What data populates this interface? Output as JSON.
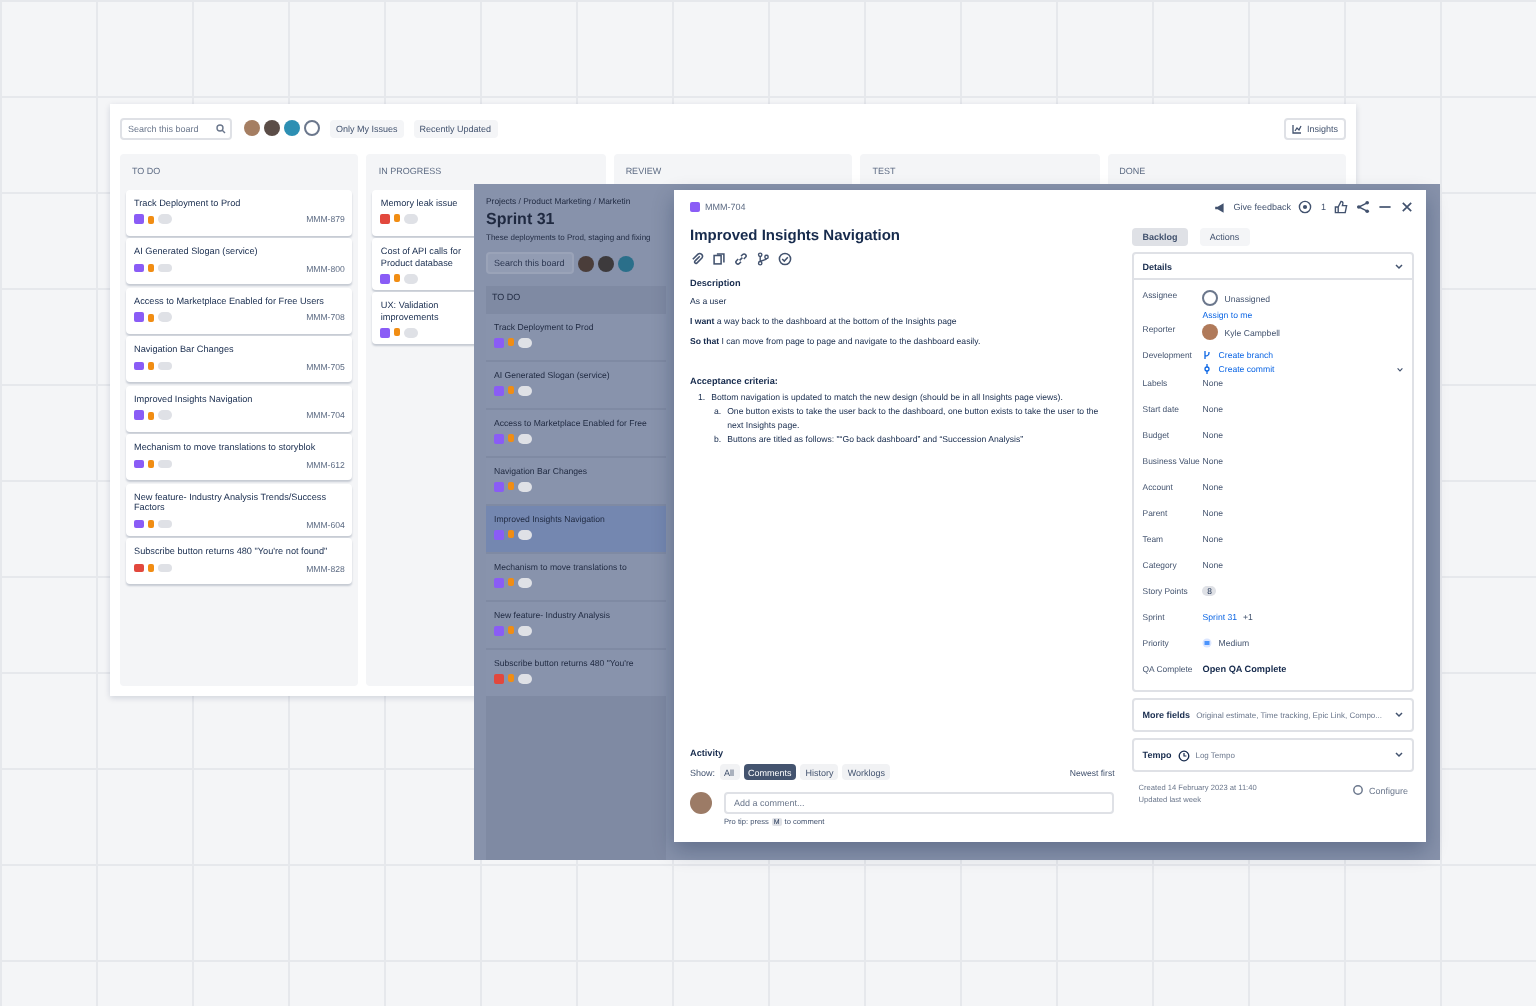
{
  "back_board": {
    "search": {
      "placeholder": "Search this board"
    },
    "filters": [
      "Only My Issues",
      "Recently Updated"
    ],
    "insights": "Insights",
    "columns": [
      {
        "title": "TO DO",
        "cards": [
          {
            "title": "Track Deployment to Prod",
            "key": "MMM-879",
            "kind": "story"
          },
          {
            "title": "AI Generated Slogan (service)",
            "key": "MMM-800",
            "kind": "story"
          },
          {
            "title": "Access to Marketplace Enabled for Free Users",
            "key": "MMM-708",
            "kind": "story"
          },
          {
            "title": "Navigation Bar Changes",
            "key": "MMM-705",
            "kind": "story"
          },
          {
            "title": "Improved Insights Navigation",
            "key": "MMM-704",
            "kind": "story"
          },
          {
            "title": "Mechanism to move translations to storyblok",
            "key": "MMM-612",
            "kind": "story"
          },
          {
            "title": "New feature- Industry Analysis Trends/Success Factors",
            "key": "MMM-604",
            "kind": "story"
          },
          {
            "title": "Subscribe button returns 480 \"You're not found\"",
            "key": "MMM-828",
            "kind": "bug"
          }
        ]
      },
      {
        "title": "IN PROGRESS",
        "cards": [
          {
            "title": "Memory leak issue",
            "kind": "bug"
          },
          {
            "title": "Cost of API calls for Product database",
            "kind": "story"
          },
          {
            "title": "UX: Validation improvements",
            "kind": "story"
          }
        ]
      },
      {
        "title": "REVIEW"
      },
      {
        "title": "TEST"
      },
      {
        "title": "DONE"
      }
    ]
  },
  "sprint_board": {
    "breadcrumb": "Projects / Product Marketing / Marketin",
    "title": "Sprint 31",
    "subtitle": "These deployments to Prod, staging and fixing",
    "search": {
      "placeholder": "Search this board"
    },
    "column": "TO DO",
    "cards": [
      {
        "title": "Track Deployment to Prod",
        "kind": "story",
        "selected": false
      },
      {
        "title": "AI Generated Slogan (service)",
        "kind": "story",
        "selected": false
      },
      {
        "title": "Access to Marketplace Enabled for Free",
        "kind": "story",
        "selected": false
      },
      {
        "title": "Navigation Bar Changes",
        "kind": "story",
        "selected": false
      },
      {
        "title": "Improved Insights Navigation",
        "kind": "story",
        "selected": true
      },
      {
        "title": "Mechanism to move translations to",
        "kind": "story",
        "selected": false
      },
      {
        "title": "New feature- Industry Analysis",
        "kind": "story",
        "selected": false
      },
      {
        "title": "Subscribe button returns 480 \"You're",
        "kind": "bug",
        "selected": false
      }
    ]
  },
  "issue": {
    "key": "MMM-704",
    "title": "Improved Insights Navigation",
    "description_label": "Description",
    "description": [
      "As a user",
      "**I want** a way back to the dashboard at the bottom of the Insights page",
      "**So that** I can move from page to page and navigate to the dashboard easily."
    ],
    "criteria_label": "Acceptance criteria:",
    "criteria": [
      {
        "marker": "1.",
        "text": "Bottom navigation is updated to match the new design (should be in all Insights page views).",
        "children": [
          {
            "marker": "a.",
            "text": "One button exists to take the user back to the dashboard, one button exists to take the user to the next Insights page."
          },
          {
            "marker": "b.",
            "text": "Buttons are titled as follows: \"“Go back dashboard” and “Succession Analysis”"
          }
        ]
      }
    ],
    "activity": {
      "label": "Activity",
      "show": "Show:",
      "tabs": [
        {
          "label": "All",
          "selected": false
        },
        {
          "label": "Comments",
          "selected": true
        },
        {
          "label": "History",
          "selected": false
        },
        {
          "label": "Worklogs",
          "selected": false
        }
      ],
      "sort": "Newest first",
      "comment": {
        "placeholder": "Add a comment..."
      },
      "tip_before": "Pro tip: press",
      "tip_key": "M",
      "tip_after": "to comment"
    },
    "feedback": "Give feedback",
    "watchers": "1",
    "status": "Backlog",
    "actions": "Actions",
    "details_label": "Details",
    "fields": [
      {
        "label": "Assignee",
        "value": "Unassigned",
        "kind": "person",
        "link": "Assign to me"
      },
      {
        "label": "Reporter",
        "value": "Kyle Campbell",
        "kind": "person"
      },
      {
        "label": "Development",
        "value": "Create branch",
        "kind": "dev",
        "second": "Create commit"
      },
      {
        "label": "Labels",
        "value": "None",
        "kind": "plain"
      },
      {
        "label": "Start date",
        "value": "None",
        "kind": "plain"
      },
      {
        "label": "Budget",
        "value": "None",
        "kind": "plain"
      },
      {
        "label": "Business Value",
        "value": "None",
        "kind": "plain"
      },
      {
        "label": "Account",
        "value": "None",
        "kind": "plain"
      },
      {
        "label": "Parent",
        "value": "None",
        "kind": "plain"
      },
      {
        "label": "Team",
        "value": "None",
        "kind": "plain"
      },
      {
        "label": "Category",
        "value": "None",
        "kind": "plain"
      },
      {
        "label": "Story Points",
        "value": "8",
        "kind": "points"
      },
      {
        "label": "Sprint",
        "value": "Sprint 31",
        "kind": "link",
        "extra": "+1"
      },
      {
        "label": "Priority",
        "value": "Medium",
        "kind": "priority"
      },
      {
        "label": "QA Complete",
        "value": "Open QA Complete",
        "kind": "strong"
      }
    ],
    "more_fields": {
      "label": "More fields",
      "hint": "Original estimate, Time tracking, Epic Link, Compo..."
    },
    "tempo": {
      "label": "Tempo",
      "action": "Log Tempo"
    },
    "created": "Created 14 February 2023 at 11:40",
    "updated": "Updated last week",
    "configure": "Configure"
  }
}
